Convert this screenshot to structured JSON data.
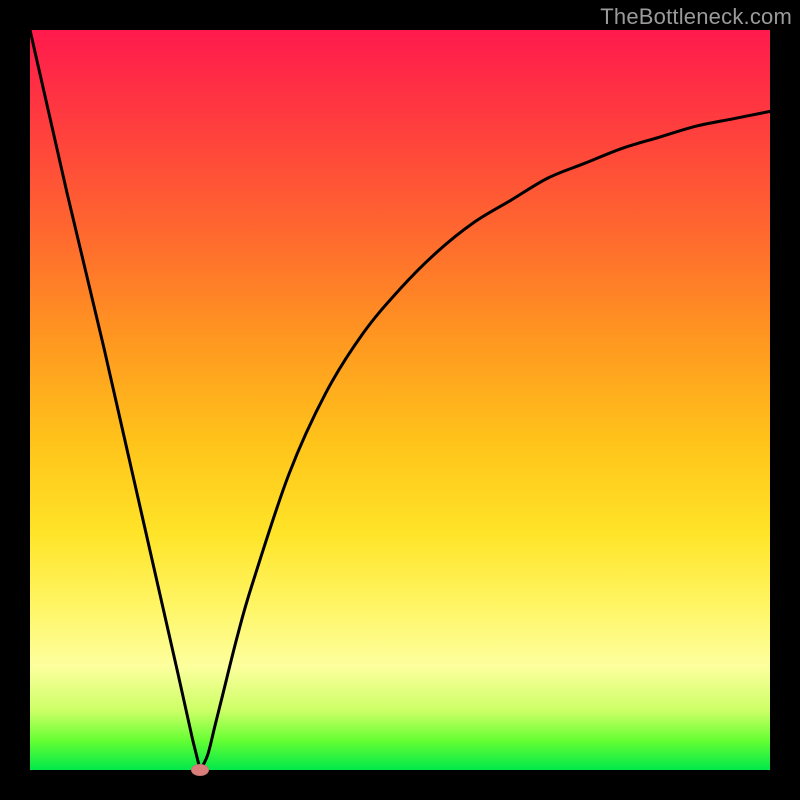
{
  "watermark": "TheBottleneck.com",
  "colors": {
    "background": "#000000",
    "gradient": [
      "#ff1a4d",
      "#ff3b3f",
      "#ff6a2e",
      "#ff9820",
      "#ffc41a",
      "#ffe428",
      "#fff666",
      "#fdff9e",
      "#ccff66",
      "#66ff33",
      "#00e84a"
    ],
    "curve": "#000000",
    "marker": "#d97e7b"
  },
  "chart_data": {
    "type": "line",
    "title": "",
    "xlabel": "",
    "ylabel": "",
    "xlim": [
      0,
      100
    ],
    "ylim": [
      0,
      100
    ],
    "series": [
      {
        "name": "bottleneck-curve",
        "x": [
          0,
          5,
          10,
          15,
          20,
          22,
          23,
          24,
          25,
          26,
          28,
          30,
          35,
          40,
          45,
          50,
          55,
          60,
          65,
          70,
          75,
          80,
          85,
          90,
          95,
          100
        ],
        "values": [
          100,
          78,
          57,
          35,
          13,
          4,
          0,
          2,
          6,
          10,
          18,
          25,
          40,
          51,
          59,
          65,
          70,
          74,
          77,
          80,
          82,
          84,
          85.5,
          87,
          88,
          89
        ]
      }
    ],
    "annotations": [
      {
        "name": "min-marker",
        "x": 23,
        "y": 0
      }
    ],
    "grid": false,
    "legend": false
  }
}
